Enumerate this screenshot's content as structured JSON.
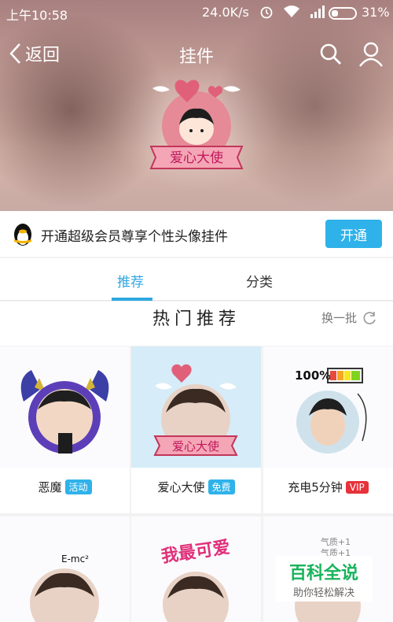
{
  "status": {
    "time": "上午10:58",
    "speed": "24.0K/s",
    "battery": "31%"
  },
  "nav": {
    "back_label": "返回",
    "title": "挂件"
  },
  "hero": {
    "badge_text": "爱心大使"
  },
  "vip_banner": {
    "text": "开通超级会员尊享个性头像挂件",
    "button": "开通"
  },
  "tabs": [
    {
      "label": "推荐"
    },
    {
      "label": "分类"
    }
  ],
  "section": {
    "title": "热门推荐",
    "refresh_label": "换一批"
  },
  "items": [
    {
      "name": "恶魔",
      "tag": "活动"
    },
    {
      "name": "爱心大使",
      "tag": "免费"
    },
    {
      "name": "充电5分钟",
      "tag": "VIP",
      "battery_text": "100%"
    }
  ],
  "row2": {
    "sticker_text": "我最可爱",
    "formula": "E-mc²",
    "aura1": "气质+1",
    "aura2": "气质+1"
  },
  "watermark": {
    "main": "百科全说",
    "sub": "助你轻松解决"
  },
  "colors": {
    "accent": "#2fa7e0",
    "vip_button": "#2fb2ea",
    "vip_tag": "#e8323a"
  }
}
